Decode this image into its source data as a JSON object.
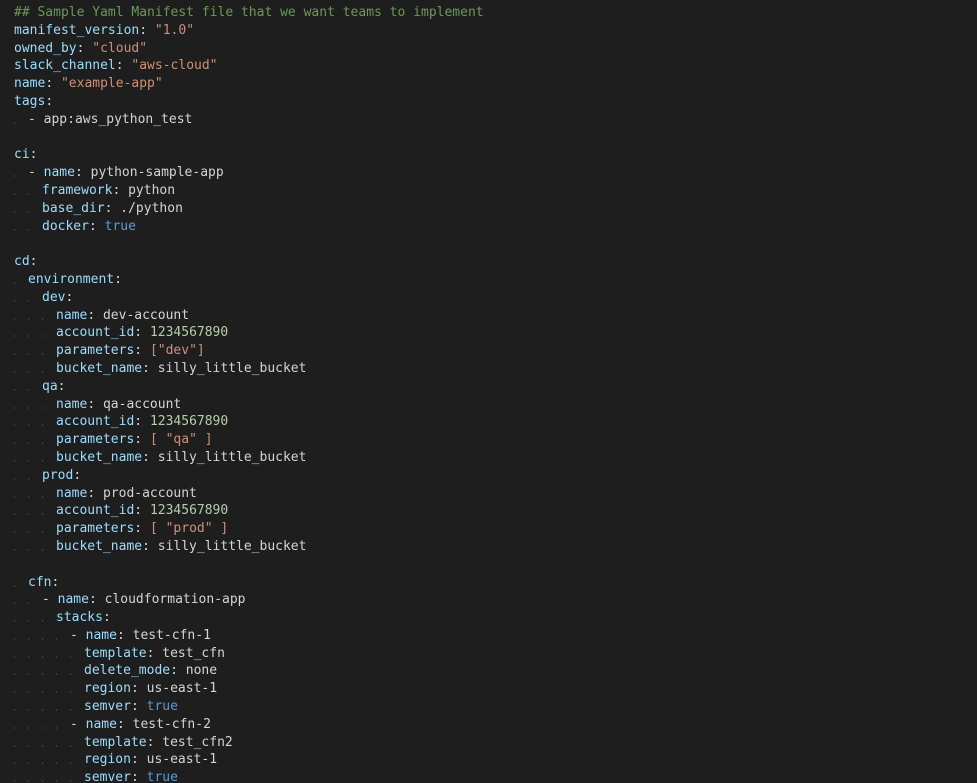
{
  "comment": "## Sample Yaml Manifest file that we want teams to implement",
  "top": {
    "manifest_version_key": "manifest_version",
    "manifest_version_val": "\"1.0\"",
    "owned_by_key": "owned_by",
    "owned_by_val": "\"cloud\"",
    "slack_channel_key": "slack_channel",
    "slack_channel_val": "\"aws-cloud\"",
    "name_key": "name",
    "name_val": "\"example-app\"",
    "tags_key": "tags",
    "tag0": "- app:aws_python_test"
  },
  "ci": {
    "key": "ci",
    "name_key": "name",
    "name_val": "python-sample-app",
    "framework_key": "framework",
    "framework_val": "python",
    "base_dir_key": "base_dir",
    "base_dir_val": "./python",
    "docker_key": "docker",
    "docker_val": "true"
  },
  "cd": {
    "key": "cd",
    "environment_key": "environment",
    "dev": {
      "key": "dev",
      "name_key": "name",
      "name_val": "dev-account",
      "account_id_key": "account_id",
      "account_id_val": "1234567890",
      "parameters_key": "parameters",
      "parameters_val": "[\"dev\"]",
      "bucket_name_key": "bucket_name",
      "bucket_name_val": "silly_little_bucket"
    },
    "qa": {
      "key": "qa",
      "name_key": "name",
      "name_val": "qa-account",
      "account_id_key": "account_id",
      "account_id_val": "1234567890",
      "parameters_key": "parameters",
      "parameters_val": "[ \"qa\" ]",
      "bucket_name_key": "bucket_name",
      "bucket_name_val": "silly_little_bucket"
    },
    "prod": {
      "key": "prod",
      "name_key": "name",
      "name_val": "prod-account",
      "account_id_key": "account_id",
      "account_id_val": "1234567890",
      "parameters_key": "parameters",
      "parameters_val": "[ \"prod\" ]",
      "bucket_name_key": "bucket_name",
      "bucket_name_val": "silly_little_bucket"
    }
  },
  "cfn": {
    "key": "cfn",
    "name_key": "name",
    "name_val": "cloudformation-app",
    "stacks_key": "stacks",
    "s1": {
      "name_key": "name",
      "name_val": "test-cfn-1",
      "template_key": "template",
      "template_val": "test_cfn",
      "delete_mode_key": "delete_mode",
      "delete_mode_val": "none",
      "region_key": "region",
      "region_val": "us-east-1",
      "semver_key": "semver",
      "semver_val": "true"
    },
    "s2": {
      "name_key": "name",
      "name_val": "test-cfn-2",
      "template_key": "template",
      "template_val": "test_cfn2",
      "region_key": "region",
      "region_val": "us-east-1",
      "semver_key": "semver",
      "semver_val": "true"
    }
  }
}
